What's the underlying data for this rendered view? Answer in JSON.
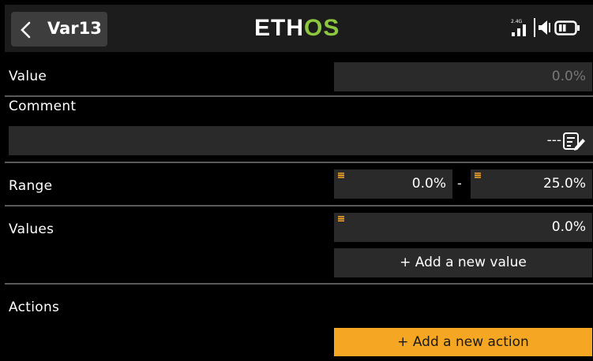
{
  "header": {
    "title": "Var13",
    "logo_main": "ETH",
    "logo_accent": "OS",
    "signal_label": "2.4G"
  },
  "value_row": {
    "label": "Value",
    "value": "0.0%"
  },
  "comment_row": {
    "label": "Comment",
    "value": "---"
  },
  "range_row": {
    "label": "Range",
    "min": "0.0%",
    "separator": "-",
    "max": "25.0%"
  },
  "values_row": {
    "label": "Values",
    "value": "0.0%",
    "add_label": "+ Add a new value"
  },
  "actions_row": {
    "label": "Actions",
    "add_label": "+ Add a new action"
  },
  "colors": {
    "accent": "#f5a623",
    "logo_green": "#8dc63f",
    "field_bg": "#2a2a2a"
  }
}
